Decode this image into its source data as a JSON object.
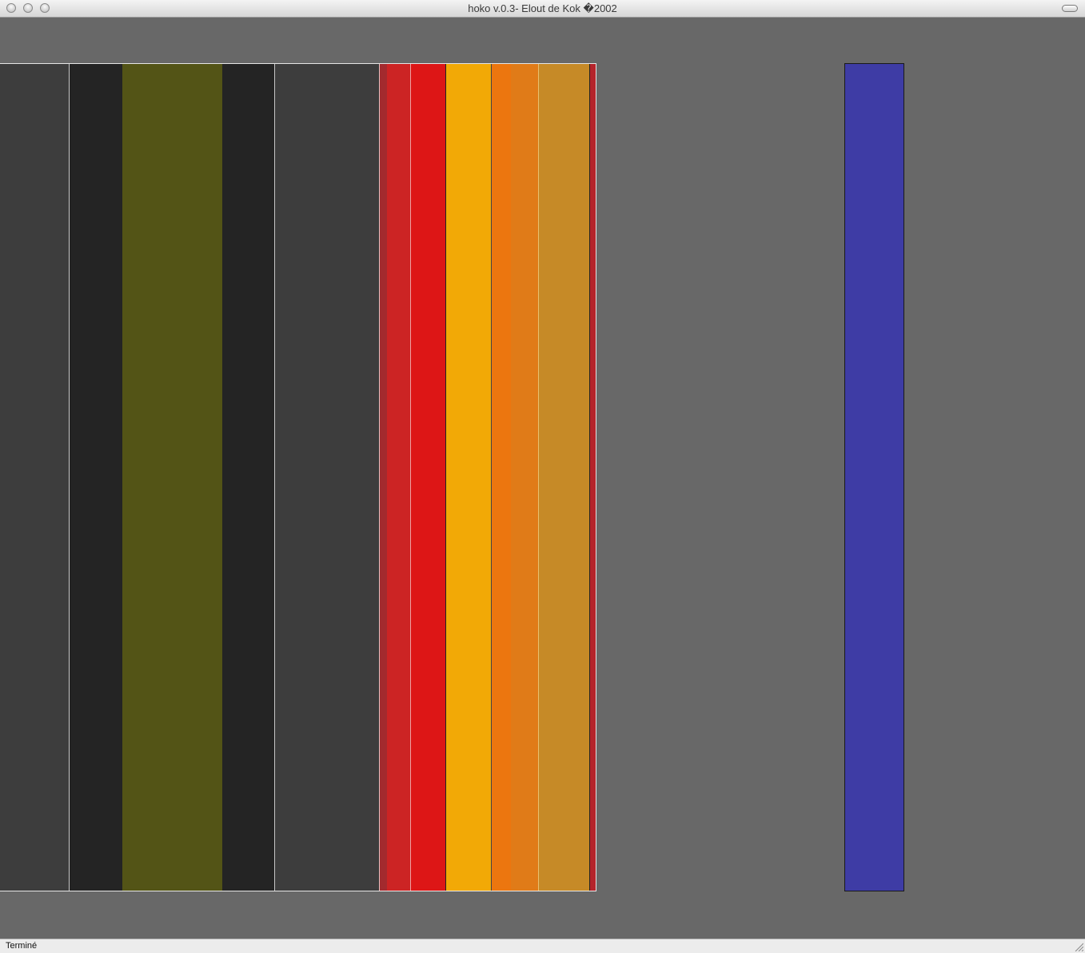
{
  "window": {
    "title": "hoko v.0.3- Elout de Kok �2002"
  },
  "status": {
    "text": "Terminé"
  },
  "colors": {
    "background": "#686868",
    "dark_gray": "#3d3d3d",
    "near_black": "#242424",
    "olive": "#535416",
    "red": "#cc2424",
    "bright_red": "#dd1616",
    "amber": "#f2a906",
    "orange": "#ec760f",
    "dark_orange": "#e07b18",
    "ochre": "#c68a27",
    "crimson": "#b5242b",
    "blue": "#3e3ca5"
  },
  "stripes": [
    {
      "name": "dark-gray",
      "color": "#3d3d3d"
    },
    {
      "name": "near-black",
      "color": "#242424"
    },
    {
      "name": "olive",
      "color": "#535416"
    },
    {
      "name": "near-black",
      "color": "#242424"
    },
    {
      "name": "dark-gray",
      "color": "#3d3d3d"
    },
    {
      "name": "thin-red",
      "color": "#a32a2e"
    },
    {
      "name": "red",
      "color": "#cc2424"
    },
    {
      "name": "bright-red",
      "color": "#dd1616"
    },
    {
      "name": "amber",
      "color": "#f2a906"
    },
    {
      "name": "orange",
      "color": "#ec760f"
    },
    {
      "name": "dark-orange",
      "color": "#e07b18"
    },
    {
      "name": "ochre",
      "color": "#c68a27"
    },
    {
      "name": "crimson",
      "color": "#b5242b"
    },
    {
      "name": "blue",
      "color": "#3e3ca5"
    }
  ]
}
